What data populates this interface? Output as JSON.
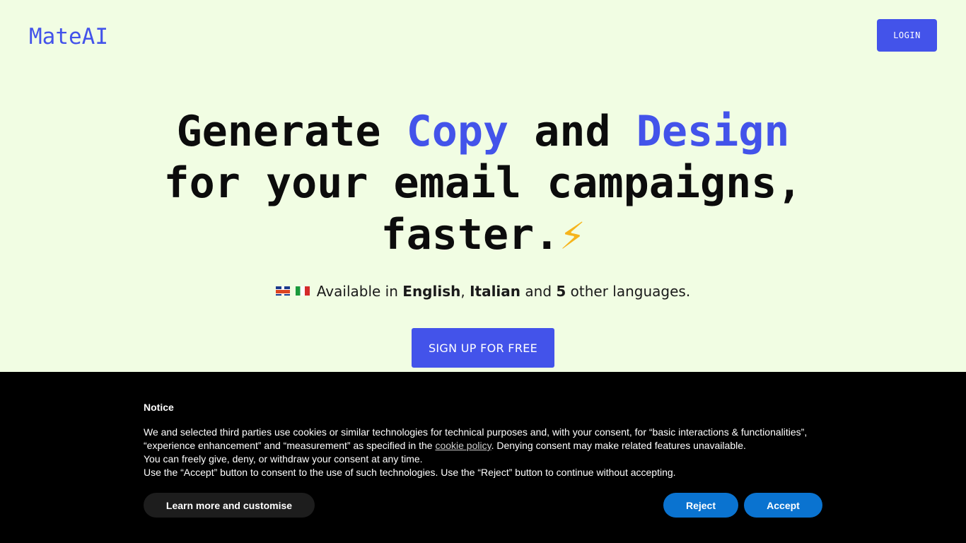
{
  "header": {
    "logo": "MateAI",
    "login_label": "LOGIN"
  },
  "hero": {
    "word_generate": "Generate",
    "word_copy": "Copy",
    "word_and": "and",
    "word_design": "Design",
    "line2": "for your email campaigns,",
    "line3": "faster.",
    "bolt": "⚡"
  },
  "languages": {
    "prefix": "Available in",
    "lang1": "English",
    "sep": ",",
    "lang2": "Italian",
    "and": "and",
    "count": "5",
    "suffix": "other languages."
  },
  "cta": {
    "signup_label": "SIGN UP FOR FREE"
  },
  "cookie_notice": {
    "title": "Notice",
    "text_before_link": "We and selected third parties use cookies or similar technologies for technical purposes and, with your consent, for “basic interactions & functionalities”, “experience enhancement” and “measurement” as specified in the",
    "link_label": "cookie policy",
    "text_after_link": ". Denying consent may make related features unavailable.",
    "line2": "You can freely give, deny, or withdraw your consent at any time.",
    "line3": "Use the “Accept” button to consent to the use of such technologies. Use the “Reject” button to continue without accepting.",
    "learn_label": "Learn more and customise",
    "reject_label": "Reject",
    "accept_label": "Accept"
  },
  "colors": {
    "background": "#f1fde3",
    "accent": "#4353ea",
    "cookie_button": "#0a73d0"
  }
}
